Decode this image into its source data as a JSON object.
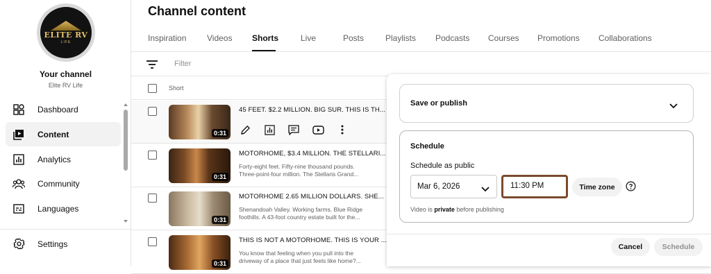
{
  "sidebar": {
    "logo_text": "ELITE RV",
    "logo_sub": "LIFE",
    "your_channel": "Your channel",
    "channel_name": "Elite RV Life",
    "items": [
      {
        "label": "Dashboard",
        "icon": "dashboard-icon"
      },
      {
        "label": "Content",
        "icon": "content-icon",
        "active": true
      },
      {
        "label": "Analytics",
        "icon": "analytics-icon"
      },
      {
        "label": "Community",
        "icon": "community-icon"
      },
      {
        "label": "Languages",
        "icon": "languages-icon"
      },
      {
        "label": "Settings",
        "icon": "gear-icon"
      }
    ]
  },
  "main": {
    "title": "Channel content",
    "tabs": [
      {
        "label": "Inspiration"
      },
      {
        "label": "Videos"
      },
      {
        "label": "Shorts",
        "active": true
      },
      {
        "label": "Live"
      },
      {
        "label": "Posts"
      },
      {
        "label": "Playlists"
      },
      {
        "label": "Podcasts"
      },
      {
        "label": "Courses"
      },
      {
        "label": "Promotions"
      },
      {
        "label": "Collaborations"
      }
    ],
    "filter_placeholder": "Filter",
    "column_header": "Short",
    "videos": [
      {
        "title": "45 FEET. $2.2 MILLION. BIG SUR. THIS IS TH...",
        "desc1": "",
        "desc2": "",
        "duration": "0:31"
      },
      {
        "title": "MOTORHOME, $3.4 MILLION. THE STELLARI...",
        "desc1": "Forty-eight feet. Fifty-nine thousand pounds.",
        "desc2": "Three-point-four million. The Stellaris Grand...",
        "duration": "0:31"
      },
      {
        "title": "MOTORHOME 2.65 MILLION DOLLARS. SHE...",
        "desc1": "Shenandoah Valley. Working farms. Blue Ridge",
        "desc2": "foothills. A 43-foot country estate built for the...",
        "duration": "0:31"
      },
      {
        "title": "THIS IS NOT A MOTORHOME. THIS IS YOUR ...",
        "desc1": "You know that feeling when you pull into the",
        "desc2": "driveway of a place that just feels like home?...",
        "duration": "0:31"
      }
    ]
  },
  "schedule_panel": {
    "save_publish_label": "Save or publish",
    "schedule_title": "Schedule",
    "schedule_subtitle": "Schedule as public",
    "date_value": "Mar 6, 2026",
    "time_value": "11:30 PM",
    "timezone_label": "Time zone",
    "note_prefix": "Video is ",
    "note_bold": "private",
    "note_suffix": " before publishing",
    "cancel_label": "Cancel",
    "schedule_label": "Schedule"
  },
  "colors": {
    "time_highlight": "#7a4a2c",
    "logo_gold": "#e2c06b"
  }
}
